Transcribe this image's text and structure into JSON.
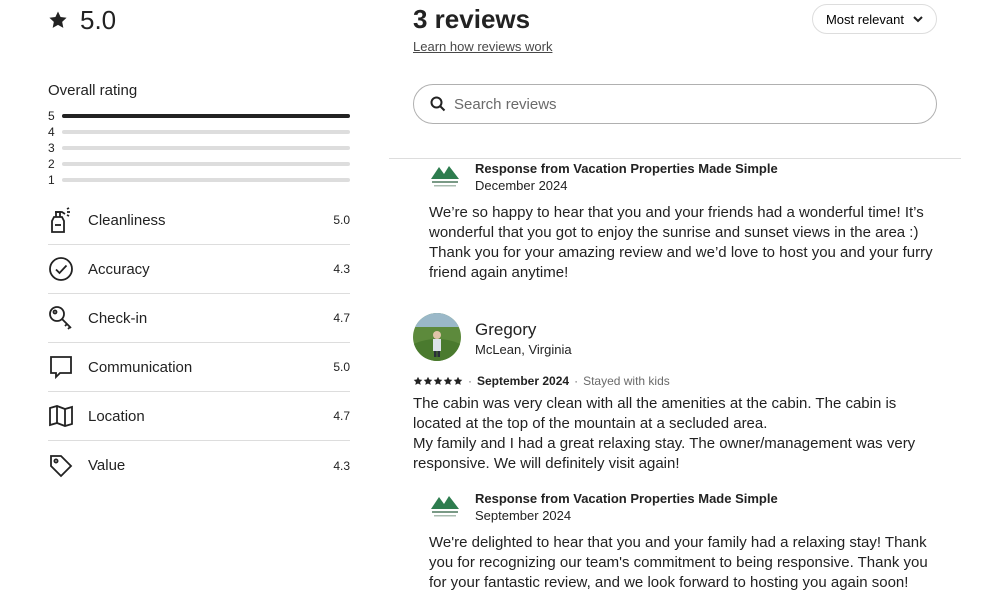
{
  "overall": {
    "score": "5.0",
    "title": "Overall rating"
  },
  "distribution": [
    {
      "label": "5",
      "fraction": 1.0
    },
    {
      "label": "4",
      "fraction": 0
    },
    {
      "label": "3",
      "fraction": 0
    },
    {
      "label": "2",
      "fraction": 0
    },
    {
      "label": "1",
      "fraction": 0
    }
  ],
  "categories": [
    {
      "label": "Cleanliness",
      "value": "5.0",
      "icon": "spray-bottle-icon"
    },
    {
      "label": "Accuracy",
      "value": "4.3",
      "icon": "check-circle-icon"
    },
    {
      "label": "Check-in",
      "value": "4.7",
      "icon": "key-icon"
    },
    {
      "label": "Communication",
      "value": "5.0",
      "icon": "chat-bubble-icon"
    },
    {
      "label": "Location",
      "value": "4.7",
      "icon": "map-icon"
    },
    {
      "label": "Value",
      "value": "4.3",
      "icon": "tag-icon"
    }
  ],
  "header": {
    "title": "3 reviews",
    "learn_link": "Learn how reviews work",
    "sort_label": "Most relevant"
  },
  "search": {
    "placeholder": "Search reviews"
  },
  "response1": {
    "name": "Response from Vacation Properties Made Simple",
    "date": "December 2024",
    "text": "We’re so happy to hear that you and your friends had a wonderful time! It’s wonderful that you got to enjoy the sunrise and sunset views in the area :) Thank you for your amazing review and we’d love to host you and your furry friend again anytime!"
  },
  "review2": {
    "name": "Gregory",
    "location": "McLean, Virginia",
    "rating": 5,
    "date": "September 2024",
    "trip": "Stayed with kids",
    "text_line1": "The cabin was very clean with all the amenities at the cabin. The cabin is located at the top of the mountain at a secluded area.",
    "text_line2": "My family and I had a great relaxing stay. The owner/management was very responsive. We will definitely visit again!"
  },
  "response2": {
    "name": "Response from Vacation Properties Made Simple",
    "date": "September 2024",
    "text": "We're delighted to hear that you and your family had a relaxing stay! Thank you for recognizing our team's commitment to being responsive. Thank you for your fantastic review, and we look forward to hosting you again soon!"
  },
  "colors": {
    "text": "#222222",
    "muted": "#6a6a6a",
    "border": "#dddddd",
    "logo_green": "#2e7d4f"
  }
}
